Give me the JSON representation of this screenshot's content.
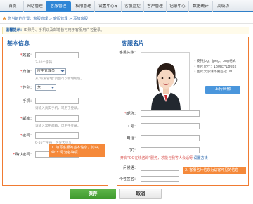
{
  "nav": {
    "tabs": [
      {
        "label": "首页"
      },
      {
        "label": "网站管理"
      },
      {
        "label": "客服管理"
      },
      {
        "label": "权限管理"
      },
      {
        "label": "设置中心"
      },
      {
        "label": "客服监控"
      },
      {
        "label": "客户管理"
      },
      {
        "label": "记录中心"
      },
      {
        "label": "数据统计"
      },
      {
        "label": "高级功"
      }
    ],
    "settings_arrow": "▼",
    "active_color": "#2f86d6"
  },
  "breadcrumb": {
    "icon": "home-icon",
    "text": "您当前的位置：客服管理 > 客服管理 > 添加客服"
  },
  "tip": {
    "label": "温馨提示：",
    "text": "ID账号、手机以及邮箱皆可用于客服用户名登录。"
  },
  "basic_info": {
    "title": "基本信息",
    "fields": {
      "name": {
        "label": "姓名："
      },
      "role": {
        "label": "角色：",
        "value": "应用管理员"
      },
      "role_hint": "从“权限管理”页面可以新增角色。",
      "gender": {
        "label": "性别：",
        "value": "女"
      },
      "phone": {
        "label": "手机："
      },
      "email": {
        "label": "邮箱："
      },
      "password": {
        "label": "密码："
      },
      "confirm_password": {
        "label": "确认密码："
      }
    },
    "name_hint": "2-20个字符",
    "phone_hint": "请输入真实手机，可用于登录。",
    "email_hint": "请输入常用邮箱，可用于登录。",
    "password_hint": "6-16个字符，区分大小写。",
    "callout": "1. 填写客服的基本信息，其中，带“*”号为必填项"
  },
  "card": {
    "title": "客服名片",
    "avatar_label": "客服头像：",
    "bullets": [
      "支持jpg、jpeg、png格式",
      "图片尺寸：180px*180px",
      "图片大小请不要超过1M"
    ],
    "upload_label": "上传头像",
    "nickname_label": "昵称：",
    "job_label": "工号：",
    "tel_label": "电话：",
    "qq_label": "QQ：",
    "notice_before": "开启“QQ在线咨询”服务，才能与我等人会话呀",
    "notice_link": "设置方法",
    "greeting_label": "问候语：",
    "signature_label": "个性签名：",
    "callout": "2. 客服名片信息为访客可见的信息"
  },
  "footer": {
    "save_label": "保存",
    "cancel_label": "取消"
  }
}
